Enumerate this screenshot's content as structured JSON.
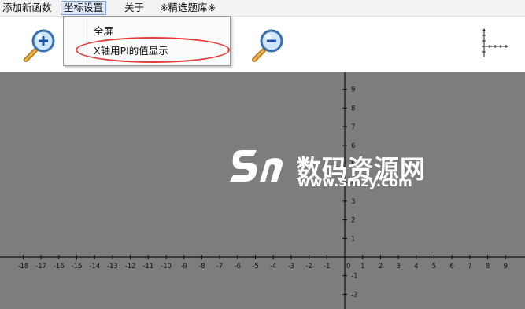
{
  "menubar": {
    "items": [
      "添加新函数",
      "坐标设置",
      "关于",
      "※精选题库※"
    ]
  },
  "dropdown": {
    "items": [
      "全屏",
      "X轴用PI的值显示"
    ]
  },
  "toolbar": {
    "zoom_in_icon": "zoom-in-icon",
    "zoom_out_icon": "zoom-out-icon",
    "axis_thumbnail_icon": "axis-thumbnail-icon"
  },
  "graph": {
    "x_tick_labels": [
      "-18",
      "-17",
      "-16",
      "-15",
      "-14",
      "-13",
      "-12",
      "-11",
      "-10",
      "-9",
      "-8",
      "-7",
      "-6",
      "-5",
      "-4",
      "-3",
      "-2",
      "-1",
      "0",
      "1",
      "2",
      "3",
      "4",
      "5",
      "6",
      "7",
      "8",
      "9"
    ],
    "y_tick_labels": [
      "9",
      "8",
      "7",
      "6",
      "5",
      "4",
      "3",
      "2",
      "1",
      "-1",
      "-2"
    ],
    "background_color": "#7d7d7d",
    "axis_color": "#111111"
  },
  "watermark": {
    "title": "数码资源网",
    "url": "www.smzy.com"
  },
  "colors": {
    "highlight_ellipse": "#e53a3a",
    "active_menu": "#dbe7f6"
  }
}
